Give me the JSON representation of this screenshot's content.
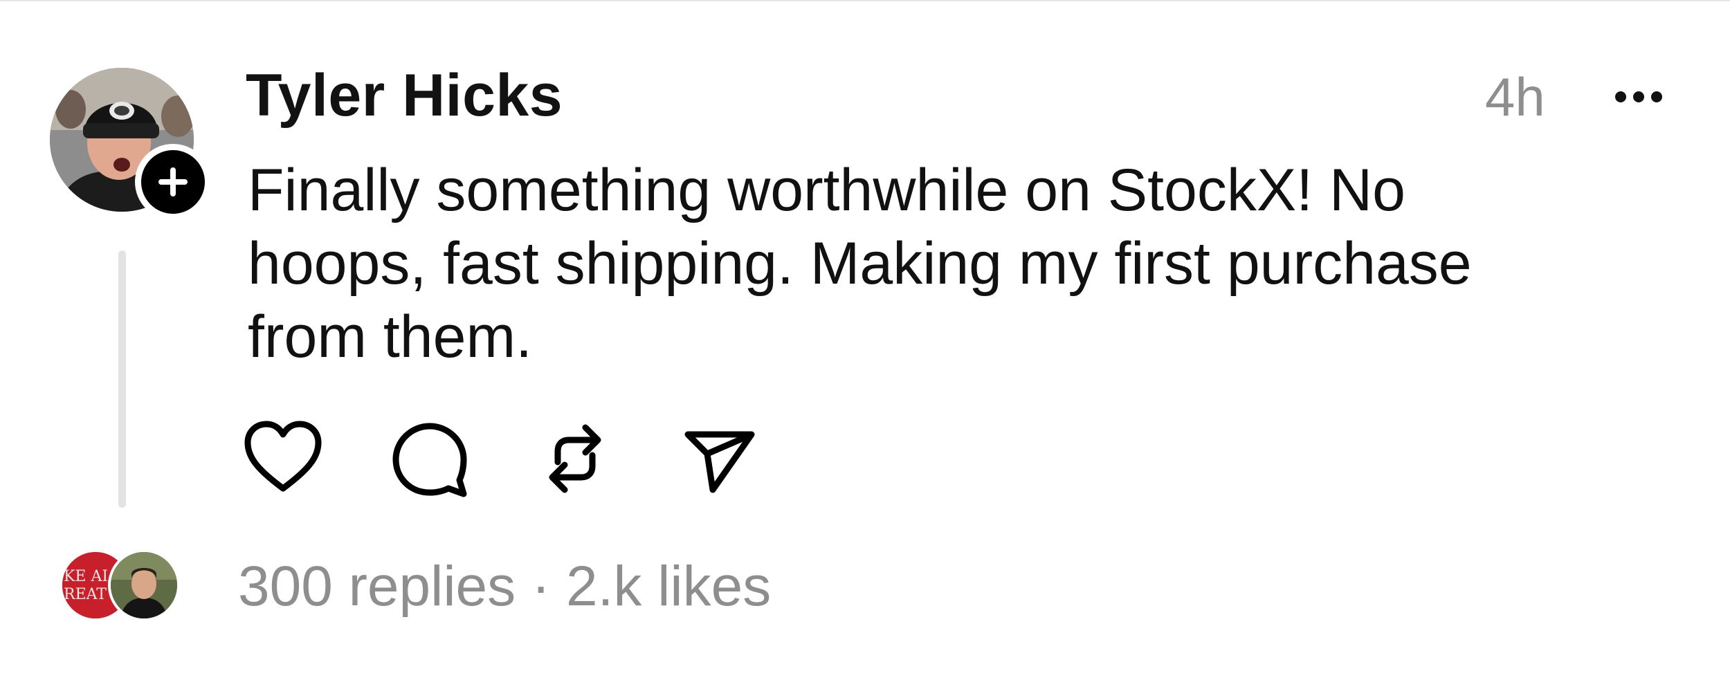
{
  "post": {
    "author": "Tyler Hicks",
    "timestamp": "4h",
    "text": "Finally something worthwhile on StockX! No hoops, fast shipping. Making my first purchase from them.",
    "replies_label": "300 replies",
    "separator": " · ",
    "likes_label": "2.k likes"
  },
  "icons": {
    "avatar": "profile-photo",
    "follow": "plus-icon",
    "more": "more-options-icon",
    "like": "heart-icon",
    "reply": "speech-bubble-icon",
    "repost": "repost-icon",
    "share": "send-icon"
  },
  "colors": {
    "text": "#111111",
    "muted": "#8e8e8e",
    "thread_line": "#e3e3e3"
  },
  "reply_avatar_text": "KE A\nREAT"
}
